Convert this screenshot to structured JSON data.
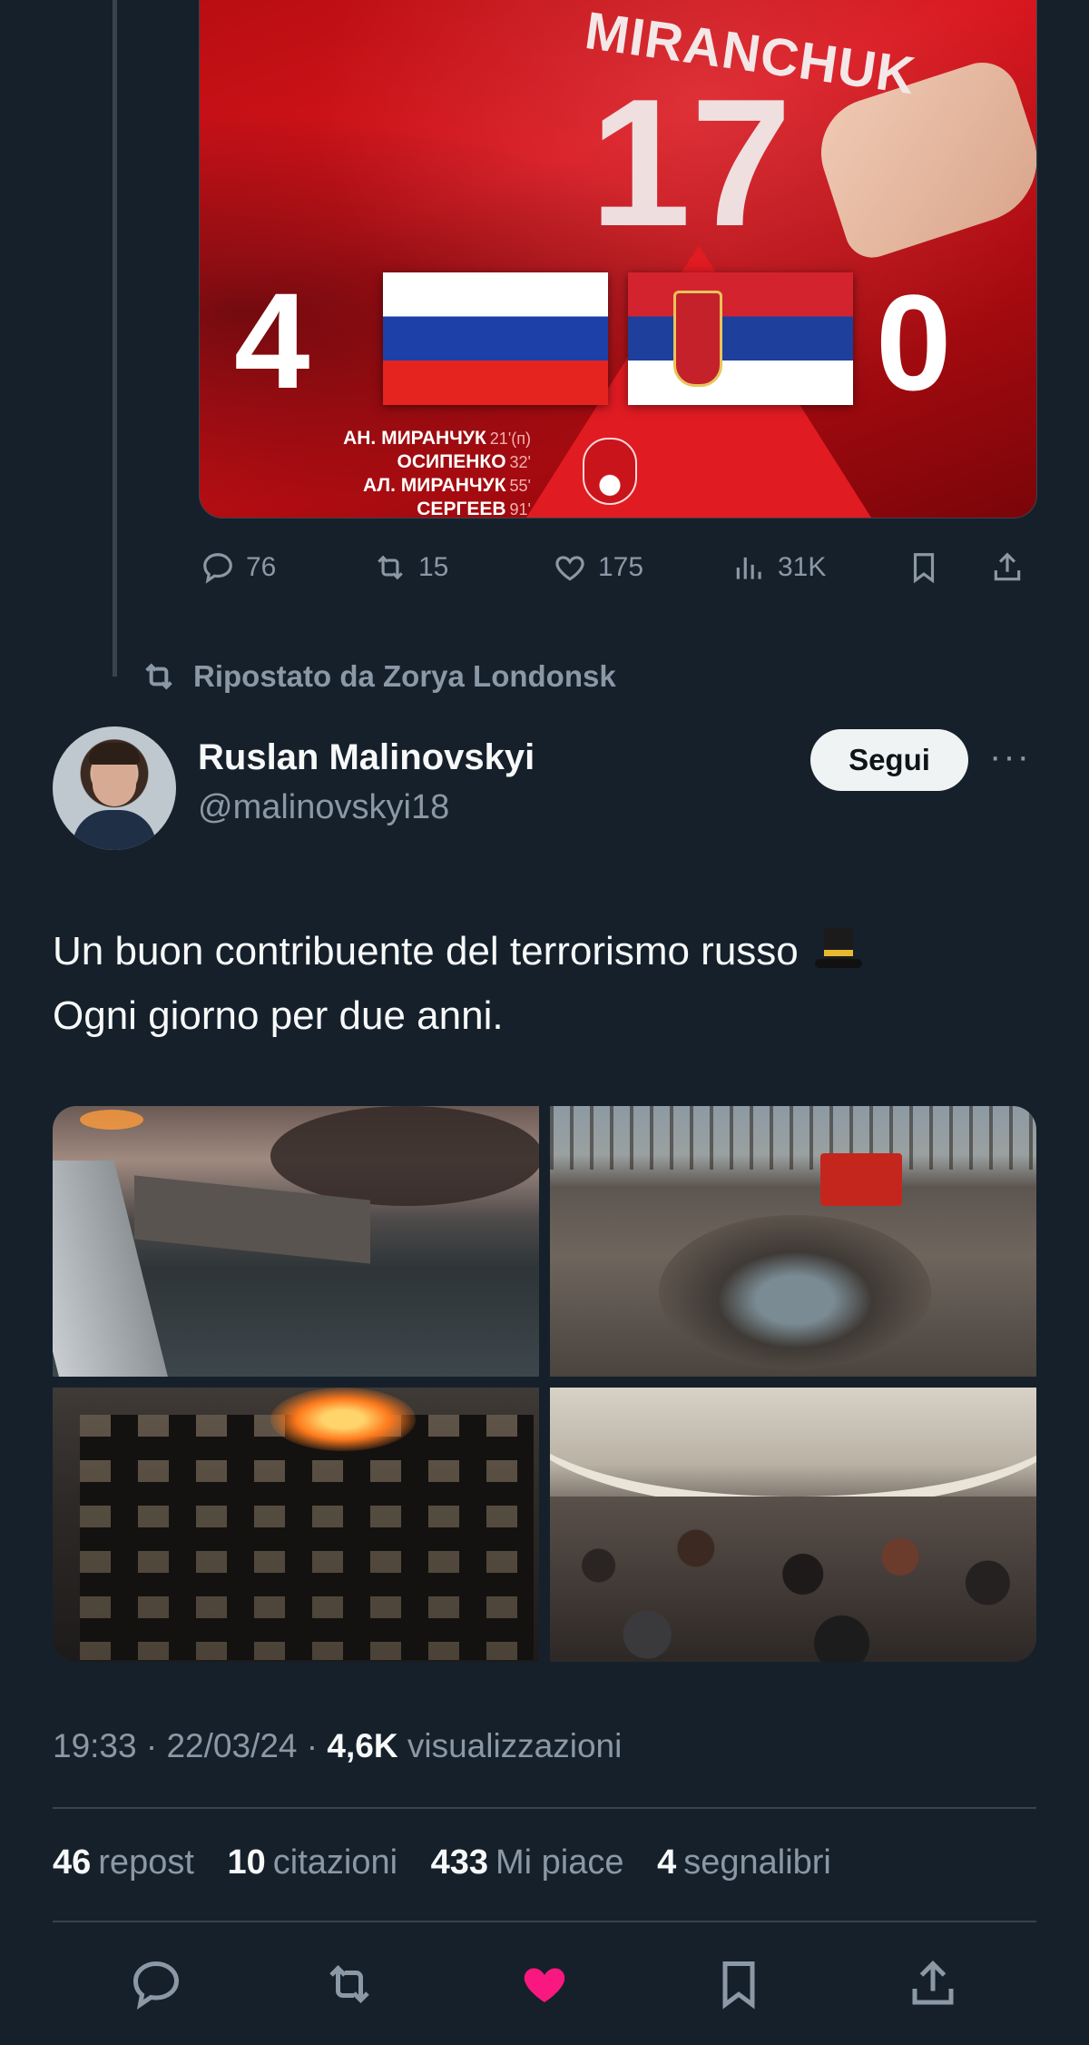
{
  "previous_tweet": {
    "media": {
      "jersey_name": "MIRANCHUK",
      "jersey_number": "17",
      "home_score": "4",
      "away_score": "0",
      "scorers": [
        {
          "name": "АН. МИРАНЧУК",
          "minute": "21'(п)"
        },
        {
          "name": "ОСИПЕНКО",
          "minute": "32'"
        },
        {
          "name": "АЛ. МИРАНЧУК",
          "minute": "55'"
        },
        {
          "name": "СЕРГЕЕВ",
          "minute": "91'"
        }
      ]
    },
    "stats": {
      "replies": "76",
      "reposts": "15",
      "likes": "175",
      "views": "31K"
    }
  },
  "repost_label": "Ripostato da Zorya Londonsk",
  "author": {
    "name": "Ruslan Malinovskyi",
    "handle": "@malinovskyi18",
    "follow_label": "Segui",
    "more_label": "···"
  },
  "tweet": {
    "line1": "Un buon contribuente del terrorismo russo",
    "emoji": "top-hat",
    "line2": "Ogni giorno per due anni."
  },
  "meta": {
    "time": "19:33",
    "date": "22/03/24",
    "views_count": "4,6K",
    "views_label": "visualizzazioni",
    "separator": "·"
  },
  "counts": {
    "reposts": "46",
    "reposts_label": "repost",
    "quotes": "10",
    "quotes_label": "citazioni",
    "likes": "433",
    "likes_label": "Mi piace",
    "bookmarks": "4",
    "bookmarks_label": "segnalibri"
  },
  "colors": {
    "background": "#15202b",
    "text_primary": "#f7f9f9",
    "text_secondary": "#8b98a5",
    "like_active": "#f91880",
    "divider": "#38444d"
  },
  "icons": {
    "reply": "reply-icon",
    "repost": "repost-icon",
    "like": "heart-icon",
    "views": "views-icon",
    "bookmark": "bookmark-icon",
    "share": "share-icon"
  }
}
